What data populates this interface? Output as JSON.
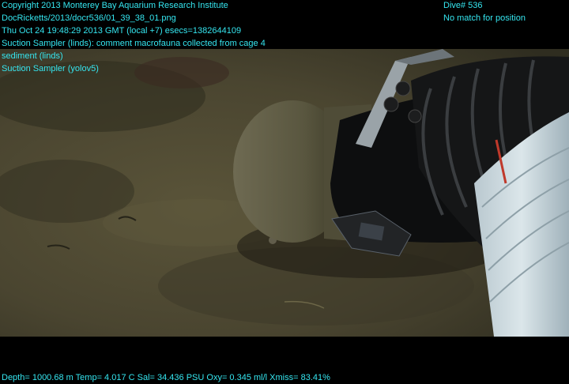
{
  "overlay": {
    "top_left": [
      "Copyright 2013 Monterey Bay Aquarium Research Institute",
      "DocRicketts/2013/docr536/01_39_38_01.png",
      "Thu Oct 24 19:48:29 2013 GMT (local +7)  esecs=1382644109",
      "Suction Sampler (linds): comment macrofauna collected from cage 4",
      "sediment (linds)",
      "Suction Sampler (yolov5)"
    ],
    "top_right": [
      "Dive# 536",
      "No match for position"
    ],
    "bottom": "Depth= 1000.68 m  Temp= 4.017 C  Sal= 34.436 PSU  Oxy= 0.345 ml/l  Xmiss= 83.41%"
  },
  "colors": {
    "text": "#35e6f0",
    "letterbox": "#000000",
    "sediment": "#4a4632"
  }
}
